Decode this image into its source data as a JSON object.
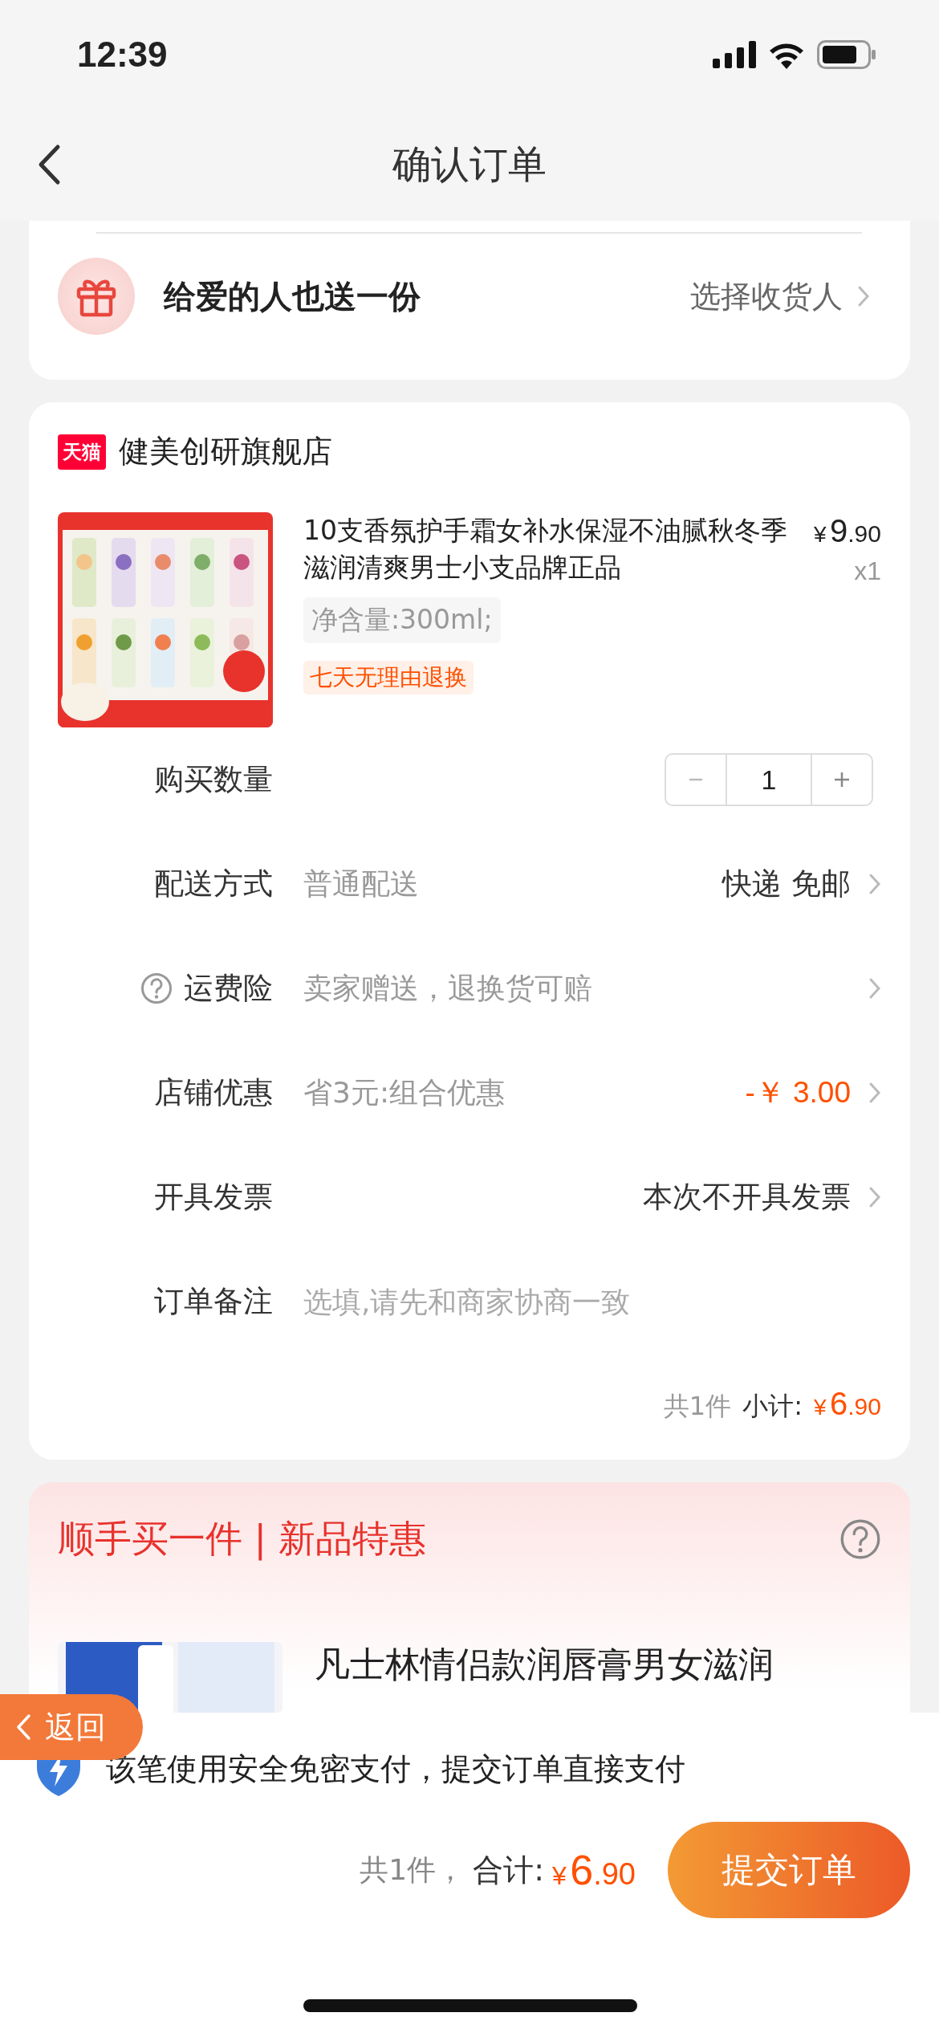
{
  "status_bar": {
    "time": "12:39"
  },
  "nav": {
    "title": "确认订单"
  },
  "gift": {
    "label": "给爱的人也送一份",
    "action": "选择收货人"
  },
  "store": {
    "badge": "天猫",
    "name": "健美创研旗舰店",
    "product": {
      "title": "10支香氛护手霜女补水保湿不油腻秋冬季滋润清爽男士小支品牌正品",
      "price_symbol": "¥",
      "price_int": "9",
      "price_dec": ".90",
      "quantity": "x1",
      "spec": "净含量:300ml;",
      "tag": "七天无理由退换"
    },
    "rows": [
      {
        "kind": "stepper",
        "label": "购买数量",
        "value": "1"
      },
      {
        "kind": "link",
        "label": "配送方式",
        "help": false,
        "detail": "普通配送",
        "value": "快递 免邮",
        "highlight": false
      },
      {
        "kind": "link",
        "label": "运费险",
        "help": true,
        "detail": "卖家赠送，退换货可赔"
      },
      {
        "kind": "link",
        "label": "店铺优惠",
        "help": false,
        "detail": "省3元:组合优惠",
        "value": "-￥ 3.00",
        "highlight": true
      },
      {
        "kind": "link",
        "label": "开具发票",
        "help": false,
        "value": "本次不开具发票",
        "highlight": false
      },
      {
        "kind": "note",
        "label": "订单备注",
        "placeholder": "选填,请先和商家协商一致"
      }
    ],
    "subtotal": {
      "count": "共1件",
      "label": "小计:",
      "symbol": "¥",
      "int": "6",
      "dec": ".90"
    }
  },
  "upsell": {
    "title": "顺手买一件 | 新品特惠",
    "product": {
      "title_lines": [
        "凡士林情侣款润唇膏男女滋润"
      ]
    }
  },
  "back_button": {
    "label": "返回"
  },
  "footer": {
    "notice": "该笔使用安全免密支付，提交订单直接支付",
    "count": "共1件，",
    "total_label": "合计:",
    "symbol": "¥",
    "int": "6",
    "dec": ".90",
    "submit": "提交订单"
  }
}
